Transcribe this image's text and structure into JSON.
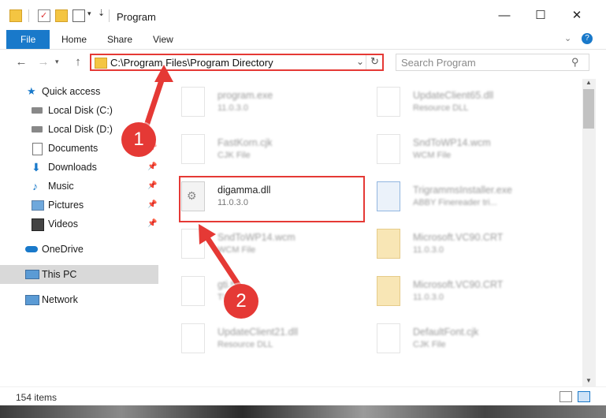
{
  "window": {
    "title": "Program",
    "minimize_glyph": "—",
    "maximize_glyph": "☐",
    "close_glyph": "✕"
  },
  "ribbon": {
    "tabs": [
      "File",
      "Home",
      "Share",
      "View"
    ]
  },
  "nav": {
    "address": "C:\\Program Files\\Program Directory",
    "search_placeholder": "Search Program"
  },
  "sidebar": {
    "items": [
      {
        "label": "Quick access",
        "icon": "star-icon",
        "pinned": false
      },
      {
        "label": "Local Disk (C:)",
        "icon": "drive-icon",
        "pinned": false
      },
      {
        "label": "Local Disk (D:)",
        "icon": "drive-icon",
        "pinned": false
      },
      {
        "label": "Documents",
        "icon": "documents-icon",
        "pinned": true
      },
      {
        "label": "Downloads",
        "icon": "download-icon",
        "pinned": true
      },
      {
        "label": "Music",
        "icon": "music-icon",
        "pinned": true
      },
      {
        "label": "Pictures",
        "icon": "pictures-icon",
        "pinned": true
      },
      {
        "label": "Videos",
        "icon": "videos-icon",
        "pinned": true
      },
      {
        "label": "OneDrive",
        "icon": "cloud-icon",
        "pinned": false
      },
      {
        "label": "This PC",
        "icon": "computer-icon",
        "pinned": false
      },
      {
        "label": "Network",
        "icon": "network-icon",
        "pinned": false
      }
    ]
  },
  "files": [
    {
      "name": "program.exe",
      "sub": "11.0.3.0",
      "type": "exe",
      "blurred": true
    },
    {
      "name": "UpdateClient65.dll",
      "sub": "Resource DLL",
      "type": "dll",
      "blurred": true
    },
    {
      "name": "FastKorn.cjk",
      "sub": "CJK File",
      "type": "file",
      "blurred": true
    },
    {
      "name": "SndToWP14.wcm",
      "sub": "WCM File",
      "type": "file",
      "blurred": true
    },
    {
      "name": "digamma.dll",
      "sub": "11.0.3.0",
      "type": "dll",
      "blurred": false
    },
    {
      "name": "TrigrammsInstaller.exe",
      "sub": "ABBY Finereader tri...",
      "type": "installer",
      "blurred": true
    },
    {
      "name": "SndToWP14.wcm",
      "sub": "WCM File",
      "type": "file",
      "blurred": true
    },
    {
      "name": "Microsoft.VC90.CRT",
      "sub": "11.0.3.0",
      "type": "folder",
      "blurred": true
    },
    {
      "name": "gti.tk",
      "sub": "TK File",
      "type": "file",
      "blurred": true
    },
    {
      "name": "Microsoft.VC90.CRT",
      "sub": "11.0.3.0",
      "type": "folder",
      "blurred": true
    },
    {
      "name": "UpdateClient21.dll",
      "sub": "Resource DLL",
      "type": "dll",
      "blurred": true
    },
    {
      "name": "DefaultFont.cjk",
      "sub": "CJK File",
      "type": "file",
      "blurred": true
    }
  ],
  "status": {
    "item_count": "154 items"
  },
  "callouts": [
    "1",
    "2"
  ],
  "colors": {
    "accent": "#1979ca",
    "highlight": "#e53935",
    "selected_bg": "#d9d9d9"
  }
}
